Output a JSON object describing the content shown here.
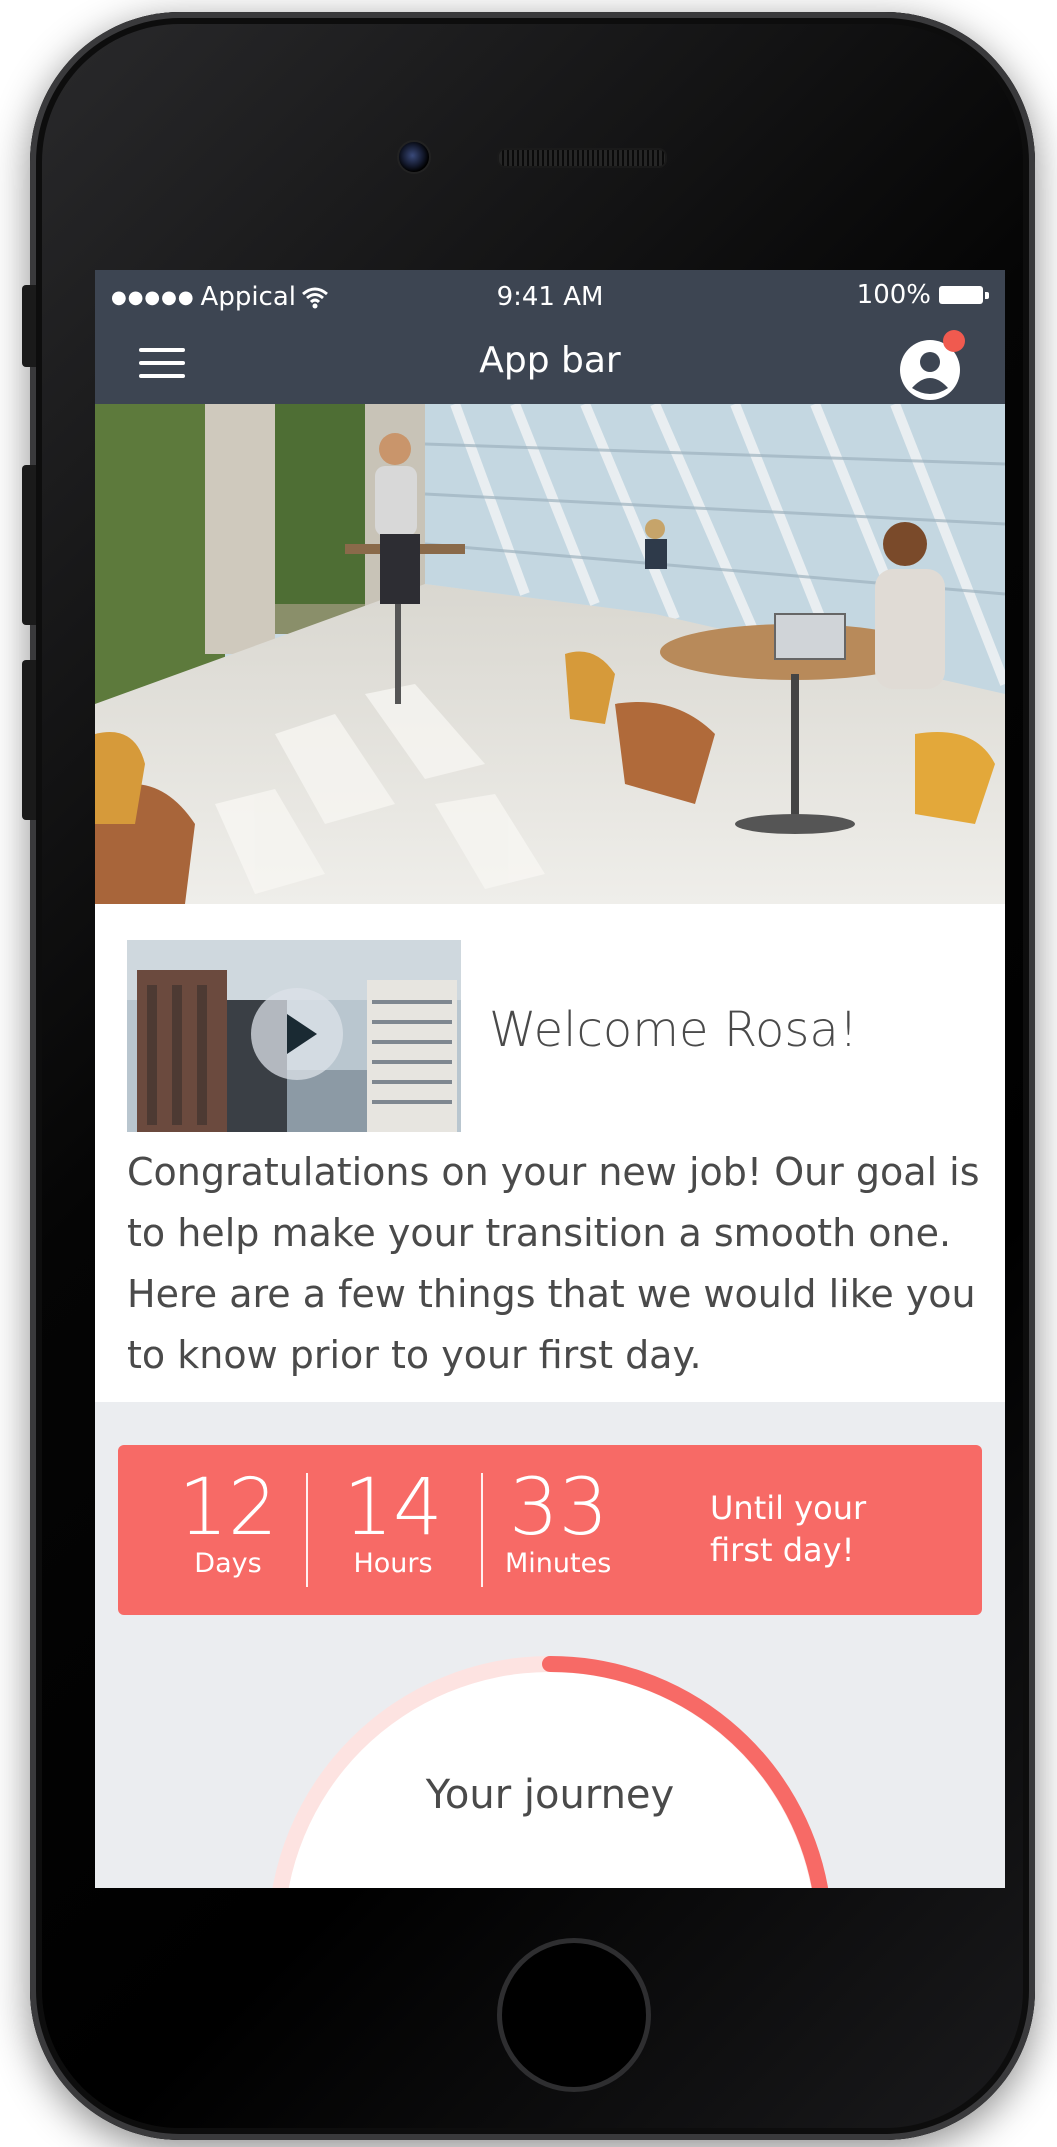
{
  "status_bar": {
    "signal": "●●●●●",
    "carrier": "Appical",
    "time": "9:41 AM",
    "battery": "100%"
  },
  "app_bar": {
    "title": "App bar"
  },
  "welcome": {
    "title": "Welcome Rosa!",
    "body": "Congratulations on your new job! Our goal is to help make your transition a smooth one. Here are a few things that we would like you to know prior to your first day."
  },
  "countdown": {
    "days": "12",
    "days_label": "Days",
    "hours": "14",
    "hours_label": "Hours",
    "minutes": "33",
    "minutes_label": "Minutes",
    "note_line1": "Until your",
    "note_line2": "first day!"
  },
  "journey": {
    "label": "Your journey"
  },
  "colors": {
    "app_bar": "#3d4552",
    "accent": "#f76a66",
    "notification": "#f05a4f",
    "background": "#ebedf0"
  },
  "icons": [
    "wifi-icon",
    "battery-icon",
    "menu-icon",
    "profile-icon",
    "play-icon"
  ]
}
